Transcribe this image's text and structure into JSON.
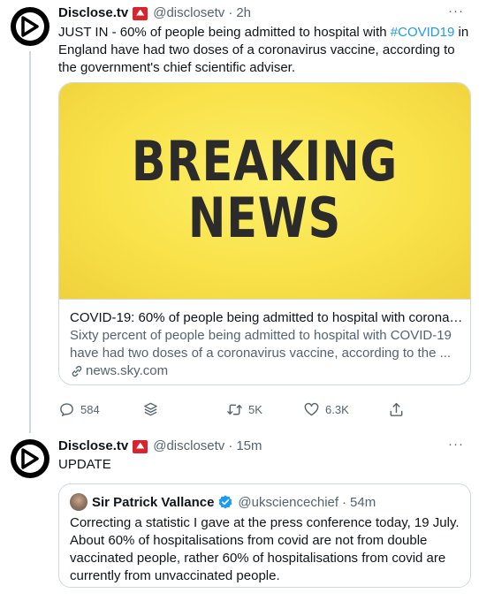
{
  "tweet1": {
    "author_name": "Disclose.tv",
    "author_handle": "@disclosetv",
    "separator": "·",
    "time": "2h",
    "more": "···",
    "text_before": "JUST IN - 60% of people being admitted to hospital with ",
    "hashtag": "#COVID19",
    "text_after": " in England have had two doses of a coronavirus vaccine, according to the government's chief scientific adviser.",
    "card": {
      "image_line1": "BREAKING",
      "image_line2": "NEWS",
      "title": "COVID-19: 60% of people being admitted to hospital with coronav...",
      "description": "Sixty percent of people being admitted to hospital with COVID-19 have had two doses of a coronavirus vaccine, according to the ...",
      "domain": "news.sky.com"
    },
    "actions": {
      "replies": "584",
      "retweets": "5K",
      "likes": "6.3K"
    }
  },
  "tweet2": {
    "author_name": "Disclose.tv",
    "author_handle": "@disclosetv",
    "separator": "·",
    "time": "15m",
    "more": "···",
    "text": "UPDATE",
    "quote": {
      "author_name": "Sir Patrick Vallance",
      "author_handle": "@uksciencechief",
      "separator": "·",
      "time": "54m",
      "text": "Correcting a statistic I gave at the press conference today, 19 July. About 60% of hospitalisations from covid are not from double vaccinated people, rather 60% of hospitalisations from covid are currently from unvaccinated people."
    }
  },
  "colors": {
    "link": "#1d9bf0",
    "secondary": "#536471",
    "border": "#cfd9de",
    "flag": "#d9232e",
    "card_yellow": "#f9e24a"
  },
  "icons": [
    "disclosetv-avatar",
    "flag-icon",
    "more-icon",
    "link-icon",
    "reply-icon",
    "stack-icon",
    "retweet-icon",
    "like-icon",
    "share-icon",
    "verified-icon"
  ]
}
